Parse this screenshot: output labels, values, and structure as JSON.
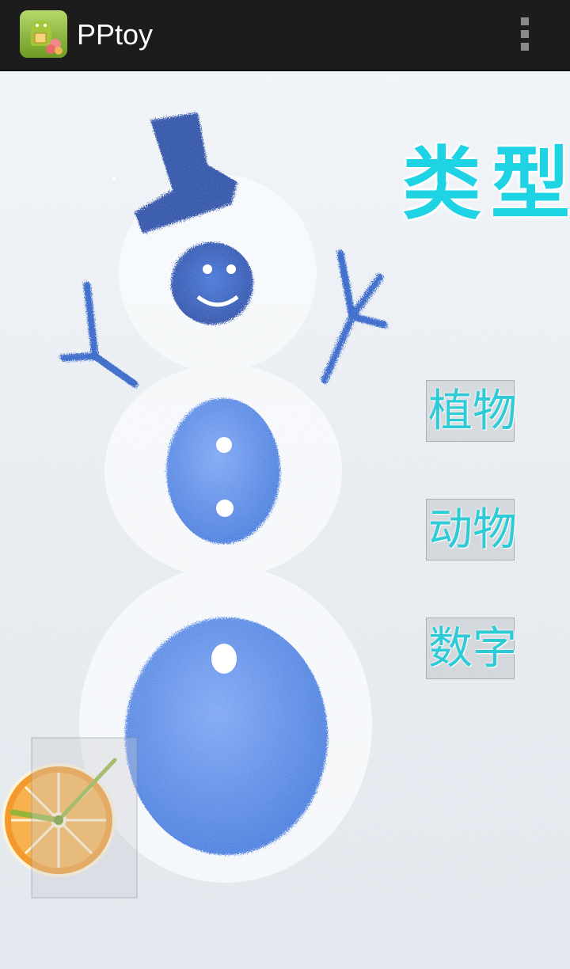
{
  "app": {
    "title": "PPtoy",
    "icon": "android-robot-app-icon",
    "overflow_icon": "overflow-menu-icon"
  },
  "main": {
    "heading": "类型",
    "categories": [
      {
        "id": "plants",
        "label": "植物"
      },
      {
        "id": "animals",
        "label": "动物"
      },
      {
        "id": "numbers",
        "label": "数字"
      }
    ]
  },
  "colors": {
    "action_bar": "#1c1c1c",
    "accent_text": "#1ed3e3",
    "snowman_blue": "#1f5fd6",
    "orange": "#f39a2e"
  },
  "clock": {
    "icon": "orange-clock-icon"
  }
}
